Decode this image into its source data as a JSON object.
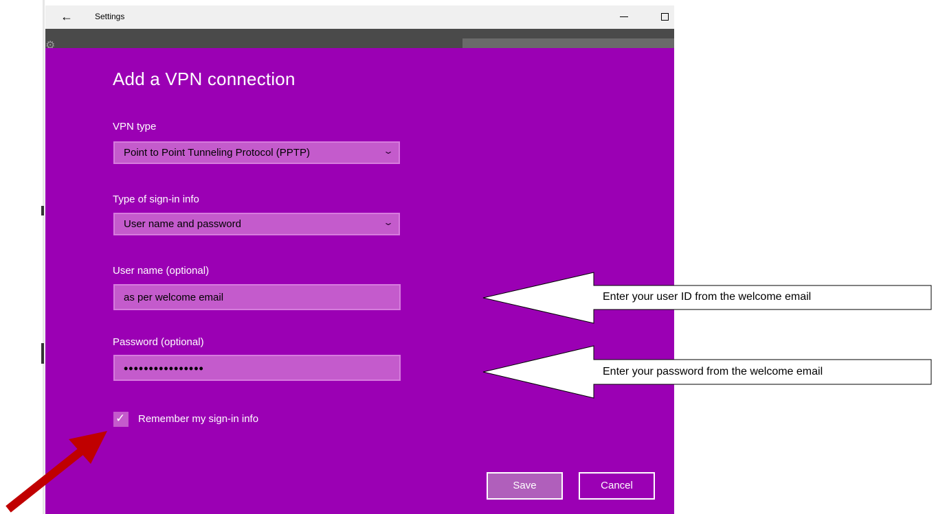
{
  "window": {
    "title": "Settings",
    "back_icon": "←",
    "minimize_icon": "minimize-icon",
    "maximize_icon": "maximize-icon"
  },
  "dialog": {
    "heading": "Add a VPN connection",
    "vpn_type": {
      "label": "VPN type",
      "value": "Point to Point Tunneling Protocol (PPTP)",
      "chevron": "⌄"
    },
    "signin_type": {
      "label": "Type of sign-in info",
      "value": "User name and password",
      "chevron": "⌄"
    },
    "username": {
      "label": "User name (optional)",
      "value": "as per welcome email"
    },
    "password": {
      "label": "Password (optional)",
      "value": "••••••••••••••••"
    },
    "remember": {
      "checked": true,
      "check_glyph": "✓",
      "label": "Remember my sign-in info"
    },
    "buttons": {
      "save": "Save",
      "cancel": "Cancel"
    },
    "accent_color": "#9b00b4"
  },
  "callouts": {
    "user_id": "Enter your user ID from the welcome email",
    "password": "Enter your password from the welcome email",
    "red_arrow_color": "#c00000"
  }
}
